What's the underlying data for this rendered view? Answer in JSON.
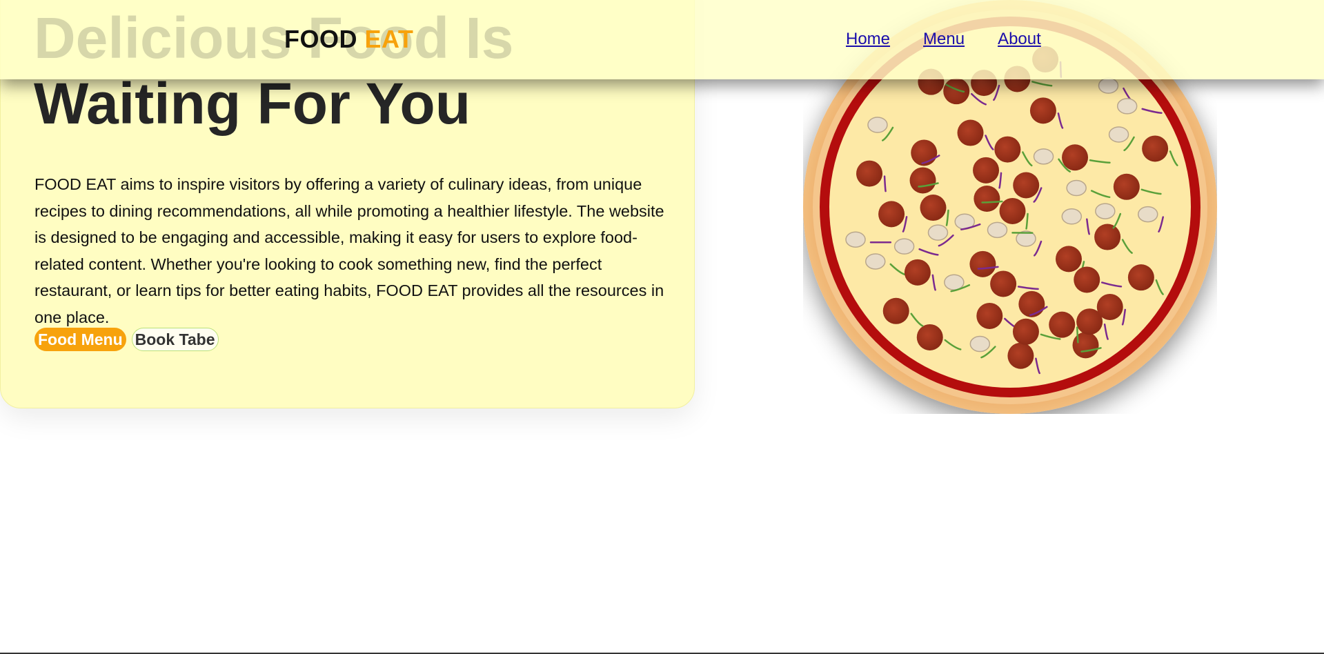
{
  "header": {
    "logo_main": "FOOD",
    "logo_accent": "EAT",
    "nav": [
      {
        "label": "Home"
      },
      {
        "label": "Menu"
      },
      {
        "label": "About"
      }
    ]
  },
  "hero": {
    "title": "Delicious Food Is\nWaiting For You",
    "description": "FOOD EAT aims to inspire visitors by offering a variety of culinary ideas, from unique recipes to dining recommendations, all while promoting a healthier lifestyle. The website is designed to be engaging and accessible, making it easy for users to explore food-related content. Whether you're looking to cook something new, find the perfect restaurant, or learn tips for better eating habits, FOOD EAT provides all the resources in one place.",
    "buttons": {
      "primary": "Food Menu",
      "secondary": "Book Tabe"
    }
  },
  "images": {
    "hero_image": "pizza-image"
  },
  "colors": {
    "accent": "#f7a20c",
    "card_bg": "#fffdc2",
    "header_bg": "#ffffc8",
    "link": "#1a0dab",
    "outline_border": "#b9e07a"
  }
}
